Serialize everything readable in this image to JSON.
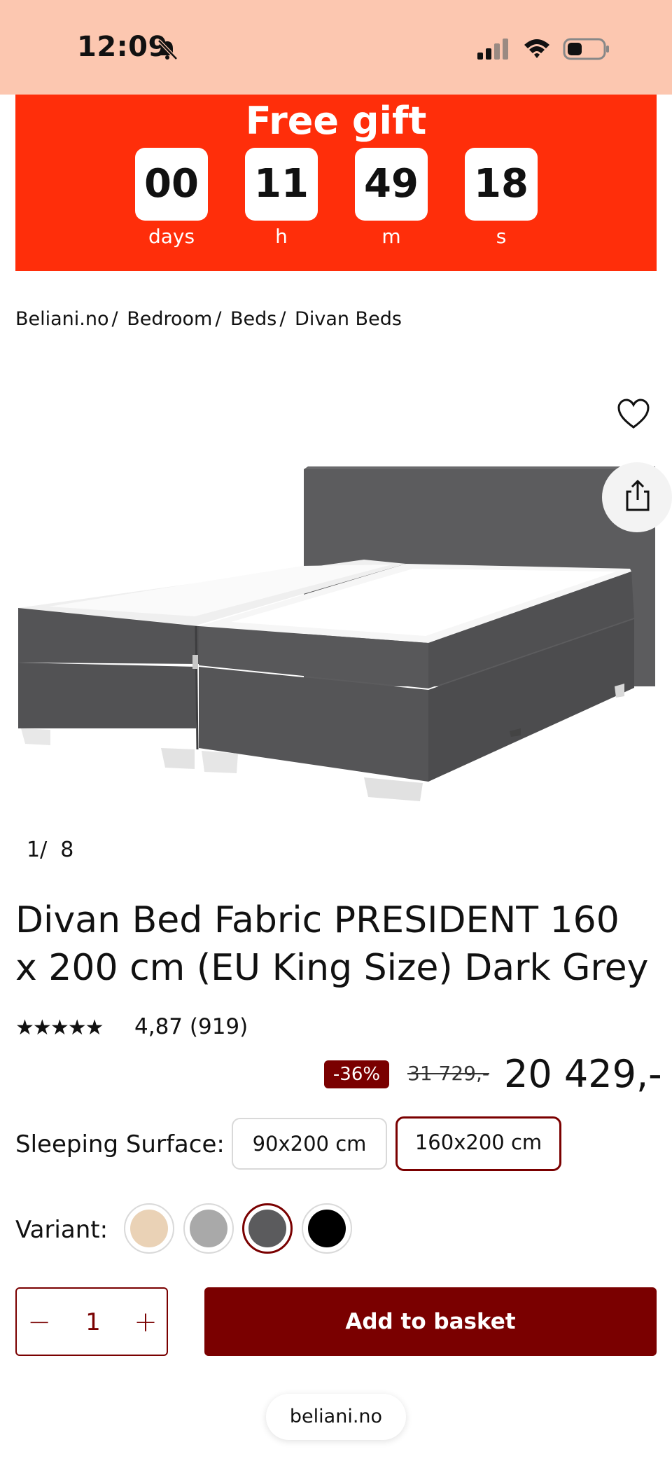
{
  "status_bar": {
    "time": "12:09"
  },
  "promo": {
    "title": "Free gift",
    "countdown": [
      {
        "value": "00",
        "label": "days"
      },
      {
        "value": "11",
        "label": "h"
      },
      {
        "value": "49",
        "label": "m"
      },
      {
        "value": "18",
        "label": "s"
      }
    ]
  },
  "breadcrumb": [
    "Beliani.no",
    "Bedroom",
    "Beds",
    "Divan Beds"
  ],
  "gallery": {
    "current": "1",
    "separator": "/",
    "total": "8"
  },
  "product": {
    "title": "Divan Bed Fabric PRESIDENT 160 x 200 cm (EU King Size) Dark Grey",
    "rating_stars": 4.87,
    "rating_text": "4,87 (919)",
    "discount": "-36%",
    "old_price": "31 729,-",
    "price": "20 429,-"
  },
  "sleeping_surface": {
    "label": "Sleeping Surface:",
    "options": [
      "90x200 cm",
      "160x200 cm"
    ],
    "selected": "160x200 cm"
  },
  "variant": {
    "label": "Variant:",
    "colors": [
      "#ead2b6",
      "#a9a9a9",
      "#5b5b5d",
      "#000000"
    ],
    "selected_index": 2
  },
  "quantity": {
    "value": "1"
  },
  "actions": {
    "add_to_basket": "Add to basket"
  },
  "browser": {
    "url": "beliani.no"
  },
  "colors": {
    "promo": "#ff2e0a",
    "brand": "#7a0000",
    "status_bar": "#fcc7b0"
  }
}
